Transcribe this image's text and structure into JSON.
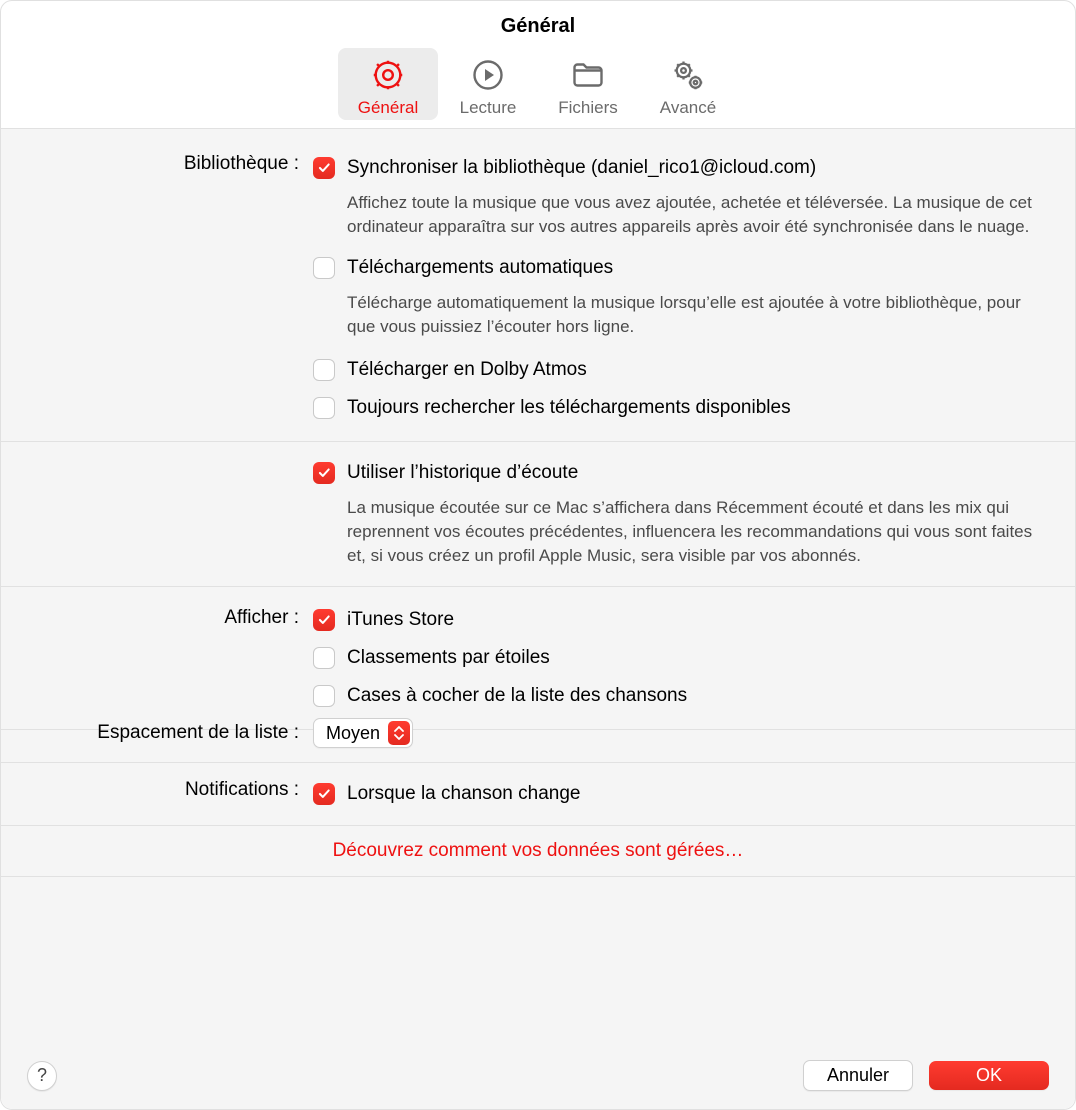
{
  "window": {
    "title": "Général"
  },
  "tabs": {
    "general": "Général",
    "playback": "Lecture",
    "files": "Fichiers",
    "advanced": "Avancé"
  },
  "labels": {
    "library": "Bibliothèque :",
    "show": "Afficher :",
    "listSpacing": "Espacement de la liste :",
    "notifications": "Notifications :"
  },
  "library": {
    "syncLabel": "Synchroniser la bibliothèque (daniel_rico1@icloud.com)",
    "syncDesc": "Affichez toute la musique que vous avez ajoutée, achetée et téléversée. La musique de cet ordinateur apparaîtra sur vos autres appareils après avoir été synchronisée dans le nuage.",
    "autoDlLabel": "Téléchargements automatiques",
    "autoDlDesc": "Télécharge automatiquement la musique lorsqu’elle est ajoutée à votre bibliothèque, pour que vous puissiez l’écouter hors ligne.",
    "dolbyLabel": "Télécharger en Dolby Atmos",
    "alwaysCheckLabel": "Toujours rechercher les téléchargements disponibles"
  },
  "history": {
    "useLabel": "Utiliser l’historique d’écoute",
    "useDesc": "La musique écoutée sur ce Mac s’affichera dans Récemment écouté et dans les mix qui reprennent vos écoutes précédentes, influencera les recommandations qui vous sont faites et, si vous créez un profil Apple Music, sera visible par vos abonnés."
  },
  "show": {
    "itunes": "iTunes Store",
    "stars": "Classements par étoiles",
    "songCheckboxes": "Cases à cocher de la liste des chansons"
  },
  "listSpacing": {
    "value": "Moyen"
  },
  "notifications": {
    "songChanges": "Lorsque la chanson change"
  },
  "privacy": {
    "link": "Découvrez comment vos données sont gérées…"
  },
  "footer": {
    "help": "?",
    "cancel": "Annuler",
    "ok": "OK"
  },
  "checked": {
    "sync": true,
    "autoDl": false,
    "dolby": false,
    "alwaysCheck": false,
    "history": true,
    "itunes": true,
    "stars": false,
    "songCheckboxes": false,
    "notif": true
  }
}
